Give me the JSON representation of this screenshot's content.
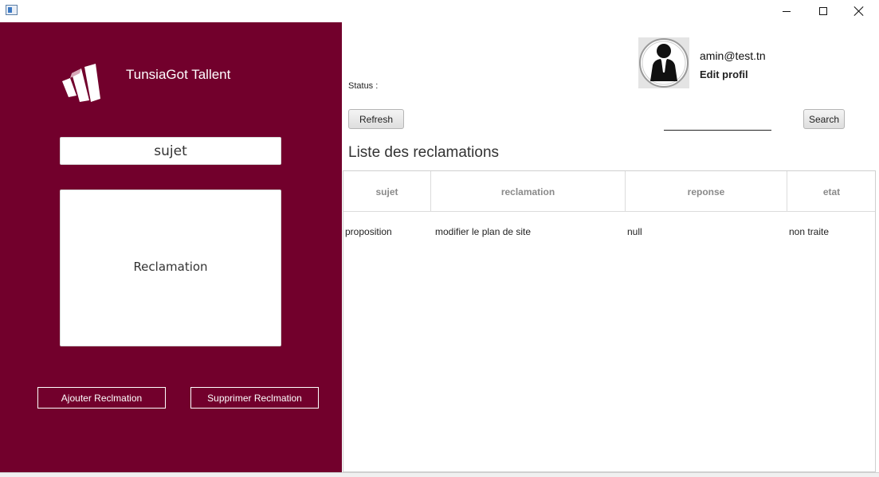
{
  "window": {
    "icons": {
      "app": "app-window-icon",
      "minimize": "minimize-icon",
      "maximize": "maximize-icon",
      "close": "close-icon"
    }
  },
  "sidebar": {
    "brand": "TunsiaGot Tallent",
    "logo_icon": "brand-logo-icon",
    "subject_placeholder": "sujet",
    "reclamation_placeholder": "Reclamation",
    "add_button": "Ajouter Reclmation",
    "delete_button": "Supprimer Reclmation",
    "background_color": "#72002c"
  },
  "header": {
    "avatar_icon": "user-avatar-icon",
    "user_email": "amin@test.tn",
    "edit_profile": "Edit profil",
    "status_label": "Status :",
    "refresh_button": "Refresh",
    "search_value": "",
    "search_button": "Search"
  },
  "list": {
    "title": "Liste des reclamations",
    "columns": [
      "sujet",
      "reclamation",
      "reponse",
      "etat"
    ],
    "rows": [
      [
        "proposition",
        "modifier le plan de site",
        "null",
        "non traite"
      ]
    ]
  }
}
